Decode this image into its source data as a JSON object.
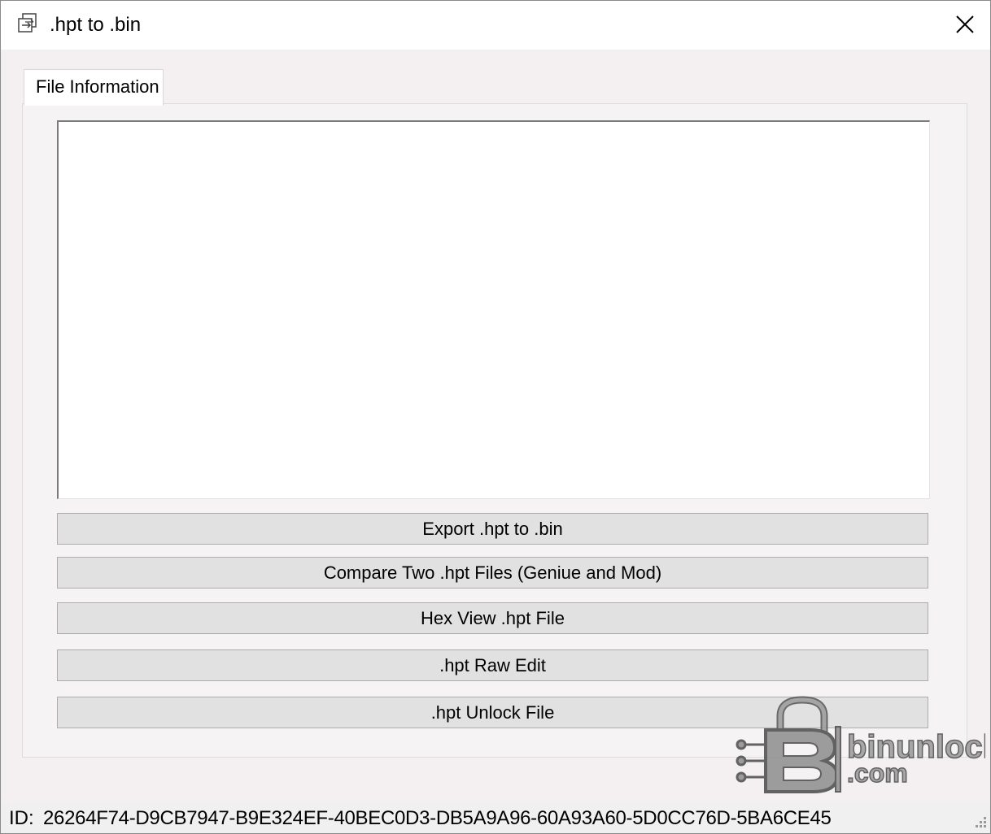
{
  "window": {
    "title": ".hpt to .bin",
    "icon": "app-icon",
    "close_icon": "close-icon"
  },
  "tabs": [
    {
      "label": "File Information",
      "selected": true
    }
  ],
  "info_box": {
    "value": ""
  },
  "buttons": {
    "export": "Export .hpt to .bin",
    "compare": "Compare Two .hpt Files (Geniue and Mod)",
    "hex_view": "Hex View .hpt File",
    "raw_edit": ".hpt Raw Edit",
    "unlock": ".hpt Unlock File"
  },
  "status": {
    "id_label": "ID:",
    "id_value": "26264F74-D9CB7947-B9E324EF-40BEC0D3-DB5A9A96-60A93A60-5D0CC76D-5BA6CE45"
  },
  "watermark": {
    "text_line1": "binunlock",
    "text_line2": ".com"
  },
  "colors": {
    "button_bg": "#e1e1e1",
    "button_border": "#adadad",
    "panel_bg": "#f6f3f5"
  }
}
